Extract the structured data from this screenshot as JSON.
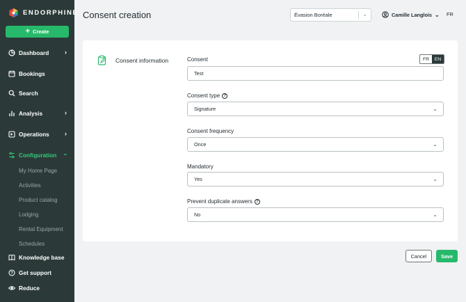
{
  "brand": {
    "name": "ENDORPHINE"
  },
  "sidebar": {
    "create_label": "Create",
    "items": [
      {
        "label": "Dashboard",
        "icon": "dashboard-icon",
        "has_chevron": true
      },
      {
        "label": "Bookings",
        "icon": "calendar-icon",
        "has_chevron": false
      },
      {
        "label": "Search",
        "icon": "search-icon",
        "has_chevron": false
      },
      {
        "label": "Analysis",
        "icon": "bar-chart-icon",
        "has_chevron": true
      },
      {
        "label": "Operations",
        "icon": "operations-icon",
        "has_chevron": true
      },
      {
        "label": "Configuration",
        "icon": "sliders-icon",
        "has_chevron": true,
        "active": true
      }
    ],
    "sub_items": [
      "My Home Page",
      "Activities",
      "Product catalog",
      "Lodging",
      "Rental Equipment",
      "Schedules"
    ],
    "footer": [
      {
        "label": "Knowledge base",
        "icon": "book-icon"
      },
      {
        "label": "Get support",
        "icon": "help-circle-icon"
      },
      {
        "label": "Reduce",
        "icon": "eye-icon"
      }
    ],
    "accent_color": "#35c97b",
    "bg_color": "#2b3a38"
  },
  "header": {
    "title": "Consent creation",
    "org_select_value": "Évasion Boréale",
    "user_name": "Camille Langlois",
    "language": "FR"
  },
  "form": {
    "section_title": "Consent information",
    "lang_toggle": {
      "fr": "FR",
      "en": "EN",
      "selected": "EN"
    },
    "consent": {
      "label": "Consent",
      "value": "Test"
    },
    "consent_type": {
      "label": "Consent type",
      "value": "Signature"
    },
    "consent_frequency": {
      "label": "Consent frequency",
      "value": "Once"
    },
    "mandatory": {
      "label": "Mandatory",
      "value": "Yes"
    },
    "prevent_duplicate": {
      "label": "Prevent duplicate answers",
      "value": "No"
    }
  },
  "actions": {
    "cancel": "Cancel",
    "save": "Save"
  }
}
